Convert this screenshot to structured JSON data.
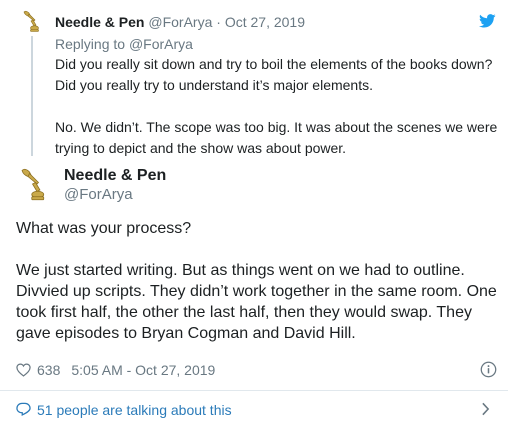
{
  "parent_tweet": {
    "author_name": "Needle & Pen",
    "author_handle": "@ForArya",
    "separator": "·",
    "date": "Oct 27, 2019",
    "replying_label": "Replying to",
    "replying_to": "@ForArya",
    "paragraphs": [
      "Did you really sit down and try to boil the elements of the books down? Did you really try to understand it’s major elements.",
      "No. We didn’t. The scope was too big. It was about the scenes we were trying to depict and the show was about power."
    ],
    "icon": "twitter-bird-icon",
    "accent_color": "#1da1f2"
  },
  "main_tweet": {
    "author_name": "Needle & Pen",
    "author_handle": "@ForArya",
    "paragraphs": [
      "What was your process?",
      "We just started writing. But as things went on we had to outline. Divvied up scripts. They didn’t work together in the same room. One took first half, the other the last half, then they would swap. They gave episodes to Bryan Cogman and David Hill."
    ],
    "like_count": "638",
    "timestamp": "5:05 AM - Oct 27, 2019",
    "icons": [
      "heart-icon",
      "info-icon"
    ]
  },
  "footer": {
    "talking_text": "51 people are talking about this",
    "link_color": "#2b7bb9",
    "icons": [
      "speech-bubble-icon",
      "chevron-right-icon"
    ]
  }
}
